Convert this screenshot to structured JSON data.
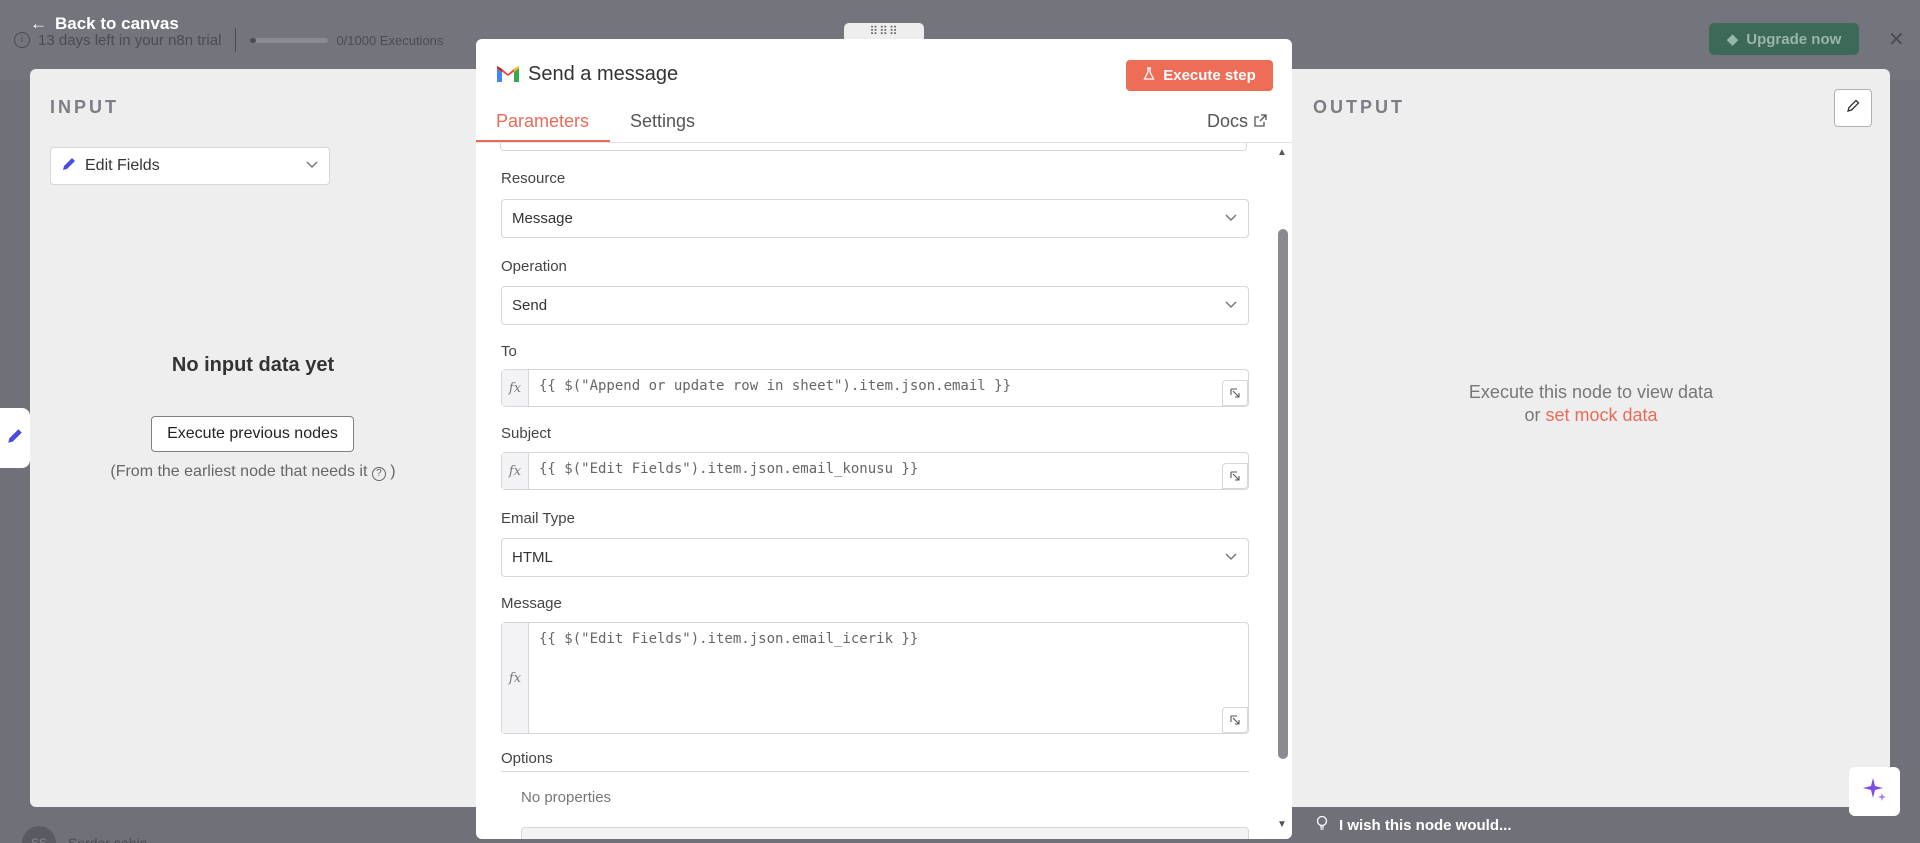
{
  "background": {
    "trial_text": "13 days left in your n8n trial",
    "executions": "0/1000 Executions",
    "executions_used_fraction": 0.0,
    "upgrade_label": "Upgrade now",
    "user_initials": "SS",
    "user_name": "Serdar sahin"
  },
  "back_to_canvas": "Back to canvas",
  "input_panel": {
    "title": "INPUT",
    "node_select": "Edit Fields",
    "empty_title": "No input data yet",
    "execute_previous": "Execute previous nodes",
    "hint": "(From the earliest node that needs it"
  },
  "output_panel": {
    "title": "OUTPUT",
    "empty_line1": "Execute this node to view data",
    "or_text": "or",
    "mock_link": "set mock data",
    "wish": "I wish this node would..."
  },
  "node": {
    "title": "Send a message",
    "execute_step": "Execute step",
    "tabs": {
      "parameters": "Parameters",
      "settings": "Settings",
      "docs": "Docs"
    },
    "fields": {
      "resource_label": "Resource",
      "resource_value": "Message",
      "operation_label": "Operation",
      "operation_value": "Send",
      "to_label": "To",
      "to_value": "{{ $(\"Append or update row in sheet\").item.json.email }}",
      "subject_label": "Subject",
      "subject_value": "{{ $(\"Edit Fields\").item.json.email_konusu }}",
      "email_type_label": "Email Type",
      "email_type_value": "HTML",
      "message_label": "Message",
      "message_value": "{{ $(\"Edit Fields\").item.json.email_icerik }}",
      "options_label": "Options",
      "options_empty": "No properties"
    },
    "fx_label": "fx"
  },
  "colors": {
    "accent": "#ea6b57",
    "execute_bg": "#ee6d57",
    "upgrade_bg": "#3d6a58"
  }
}
